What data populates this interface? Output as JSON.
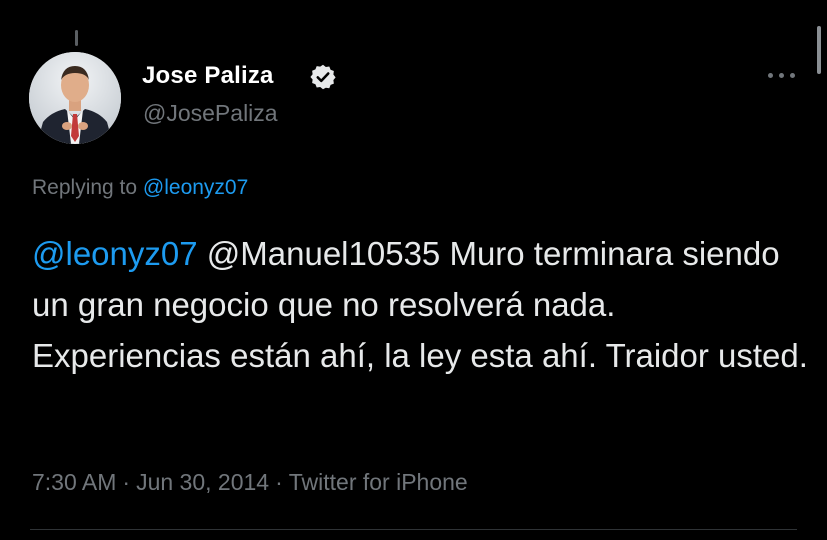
{
  "tweet": {
    "author": {
      "display_name": "Jose Paliza",
      "handle": "@JosePaliza",
      "verified": true,
      "avatar_icon": "profile-photo"
    },
    "replying_prefix": "Replying to",
    "replying_to": "@leonyz07",
    "text_mentions": [
      "@leonyz07",
      "@Manuel10535"
    ],
    "text_body": "Muro terminara siendo un gran negocio que no resolverá nada. Experiencias están ahí, la ley esta ahí. Traidor usted.",
    "time": "7:30 AM",
    "date": "Jun 30, 2014",
    "source": "Twitter for iPhone",
    "separator": "·"
  },
  "icons": {
    "verified": "verified-badge-icon",
    "more": "more-options-icon"
  },
  "colors": {
    "background": "#000000",
    "text_primary": "#e7e9ea",
    "text_secondary": "#71767b",
    "accent": "#1d9bf0"
  }
}
